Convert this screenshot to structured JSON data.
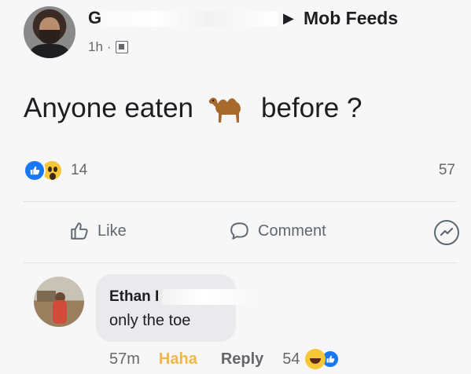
{
  "post": {
    "author_name": "G",
    "arrow_glyph": "▶",
    "group_name": "Mob Feeds",
    "time": "1h",
    "separator": "·",
    "text_before": "Anyone eaten",
    "text_after": "before ?",
    "reaction_count": "14",
    "comment_count": "57"
  },
  "actions": {
    "like_label": "Like",
    "comment_label": "Comment"
  },
  "comment": {
    "author_name": "Ethan I",
    "text": "only the toe",
    "time": "57m",
    "reaction_label": "Haha",
    "reply_label": "Reply",
    "reaction_count": "54"
  },
  "icons": {
    "like": "thumbs-up-icon",
    "wow": "wow-reaction-icon",
    "haha": "haha-reaction-icon",
    "comment": "speech-bubble-icon",
    "messenger": "messenger-icon",
    "camel": "camel-emoji-icon",
    "privacy": "group-privacy-icon"
  },
  "colors": {
    "facebook_blue": "#1877f2",
    "haha_yellow": "#f2b64a",
    "muted_text": "#65676b"
  }
}
